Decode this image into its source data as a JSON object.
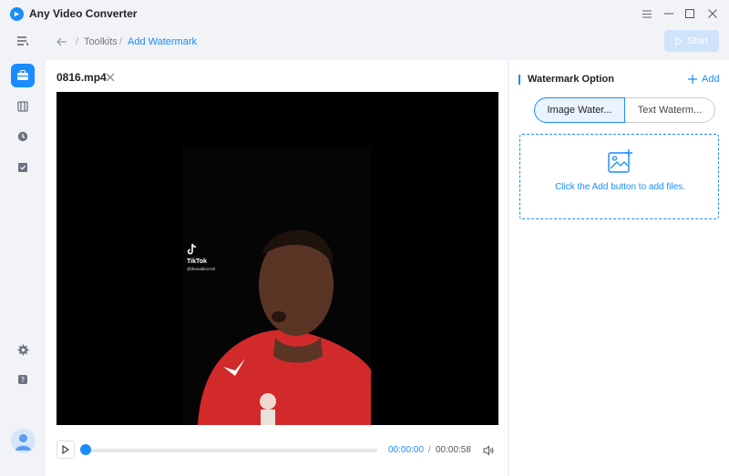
{
  "app": {
    "title": "Any Video Converter"
  },
  "breadcrumb": {
    "items": [
      "Toolkits",
      "Add Watermark"
    ],
    "separator": "/"
  },
  "toolbar": {
    "start_label": "Start"
  },
  "file": {
    "name": "0816.mp4"
  },
  "video_overlay": {
    "brand": "TikTok",
    "user": "@thenaldocrich"
  },
  "player": {
    "current_time": "00:00:00",
    "separator": "/",
    "total_time": "00:00:58",
    "progress": 0
  },
  "watermark": {
    "title": "Watermark Option",
    "add_label": "Add",
    "tabs": [
      "Image Water...",
      "Text Waterm..."
    ],
    "active_tab": 0,
    "dropzone_text": "Click the Add button to add files."
  },
  "icons": {
    "rail": [
      "menu-icon",
      "toolbox-icon",
      "film-icon",
      "history-icon",
      "tasks-icon",
      "settings-icon",
      "help-icon"
    ],
    "window": [
      "hamburger-icon",
      "minimize-icon",
      "maximize-icon",
      "close-icon"
    ]
  },
  "colors": {
    "accent": "#1a8cff",
    "start_disabled": "#cfe3fb",
    "background": "#f1f3f7"
  }
}
